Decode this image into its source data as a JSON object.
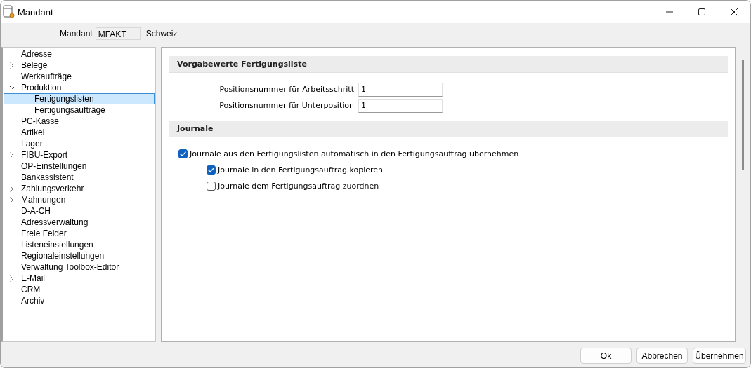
{
  "window": {
    "title": "Mandant"
  },
  "header": {
    "label": "Mandant",
    "value": "MFAKT",
    "name": "Schweiz"
  },
  "sidebar": {
    "items": [
      {
        "label": "Adresse"
      },
      {
        "label": "Belege",
        "expanded": false
      },
      {
        "label": "Werkaufträge"
      },
      {
        "label": "Produktion",
        "expanded": true,
        "children": [
          {
            "label": "Fertigungslisten",
            "selected": true
          },
          {
            "label": "Fertigungsaufträge",
            "selected": false
          }
        ]
      },
      {
        "label": "PC-Kasse"
      },
      {
        "label": "Artikel"
      },
      {
        "label": "Lager"
      },
      {
        "label": "FIBU-Export",
        "expanded": false
      },
      {
        "label": "OP-Einstellungen"
      },
      {
        "label": "Bankassistent"
      },
      {
        "label": "Zahlungsverkehr",
        "expanded": false
      },
      {
        "label": "Mahnungen",
        "expanded": false
      },
      {
        "label": "D-A-CH"
      },
      {
        "label": "Adressverwaltung"
      },
      {
        "label": "Freie Felder"
      },
      {
        "label": "Listeneinstellungen"
      },
      {
        "label": "Regionaleinstellungen"
      },
      {
        "label": "Verwaltung Toolbox-Editor"
      },
      {
        "label": "E-Mail",
        "expanded": false
      },
      {
        "label": "CRM"
      },
      {
        "label": "Archiv"
      }
    ]
  },
  "sections": [
    {
      "title": "Vorgabewerte Fertigungsliste",
      "items": [
        {
          "kind": "field",
          "label": "Positionsnummer für Arbeitsschritt",
          "value": "1"
        },
        {
          "kind": "field",
          "label": "Positionsnummer für Unterposition",
          "value": "1"
        }
      ]
    },
    {
      "title": "Journale",
      "items": [
        {
          "kind": "checkbox",
          "label": "Journale aus den Fertigungslisten automatisch in den Fertigungsauftrag übernehmen",
          "checked": true,
          "nested": false
        },
        {
          "kind": "checkbox",
          "label": "Journale in den Fertigungsauftrag kopieren",
          "checked": true,
          "nested": true
        },
        {
          "kind": "checkbox",
          "label": "Journale dem Fertigungsauftrag zuordnen",
          "checked": false,
          "nested": true
        }
      ]
    }
  ],
  "buttons": [
    "Ok",
    "Abbrechen",
    "Übernehmen"
  ]
}
